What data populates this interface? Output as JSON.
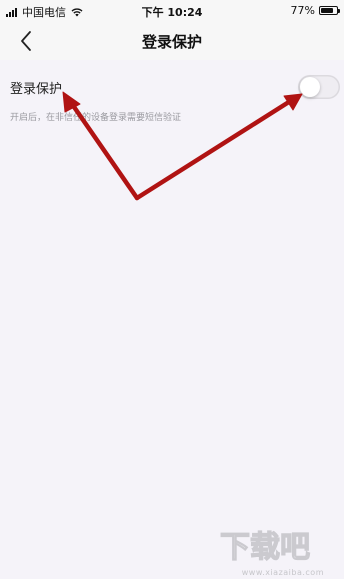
{
  "status_bar": {
    "carrier": "中国电信",
    "time": "下午 10:24",
    "battery_percent": "77%",
    "battery_level": 0.77
  },
  "nav": {
    "title": "登录保护",
    "back_icon": "chevron-left-icon"
  },
  "setting": {
    "label": "登录保护",
    "enabled": false,
    "description": "开启后，在非信任的设备登录需要短信验证"
  },
  "annotation": {
    "color": "#b01313"
  },
  "watermark": {
    "text": "下载吧",
    "url": "www.xiazaiba.com"
  }
}
